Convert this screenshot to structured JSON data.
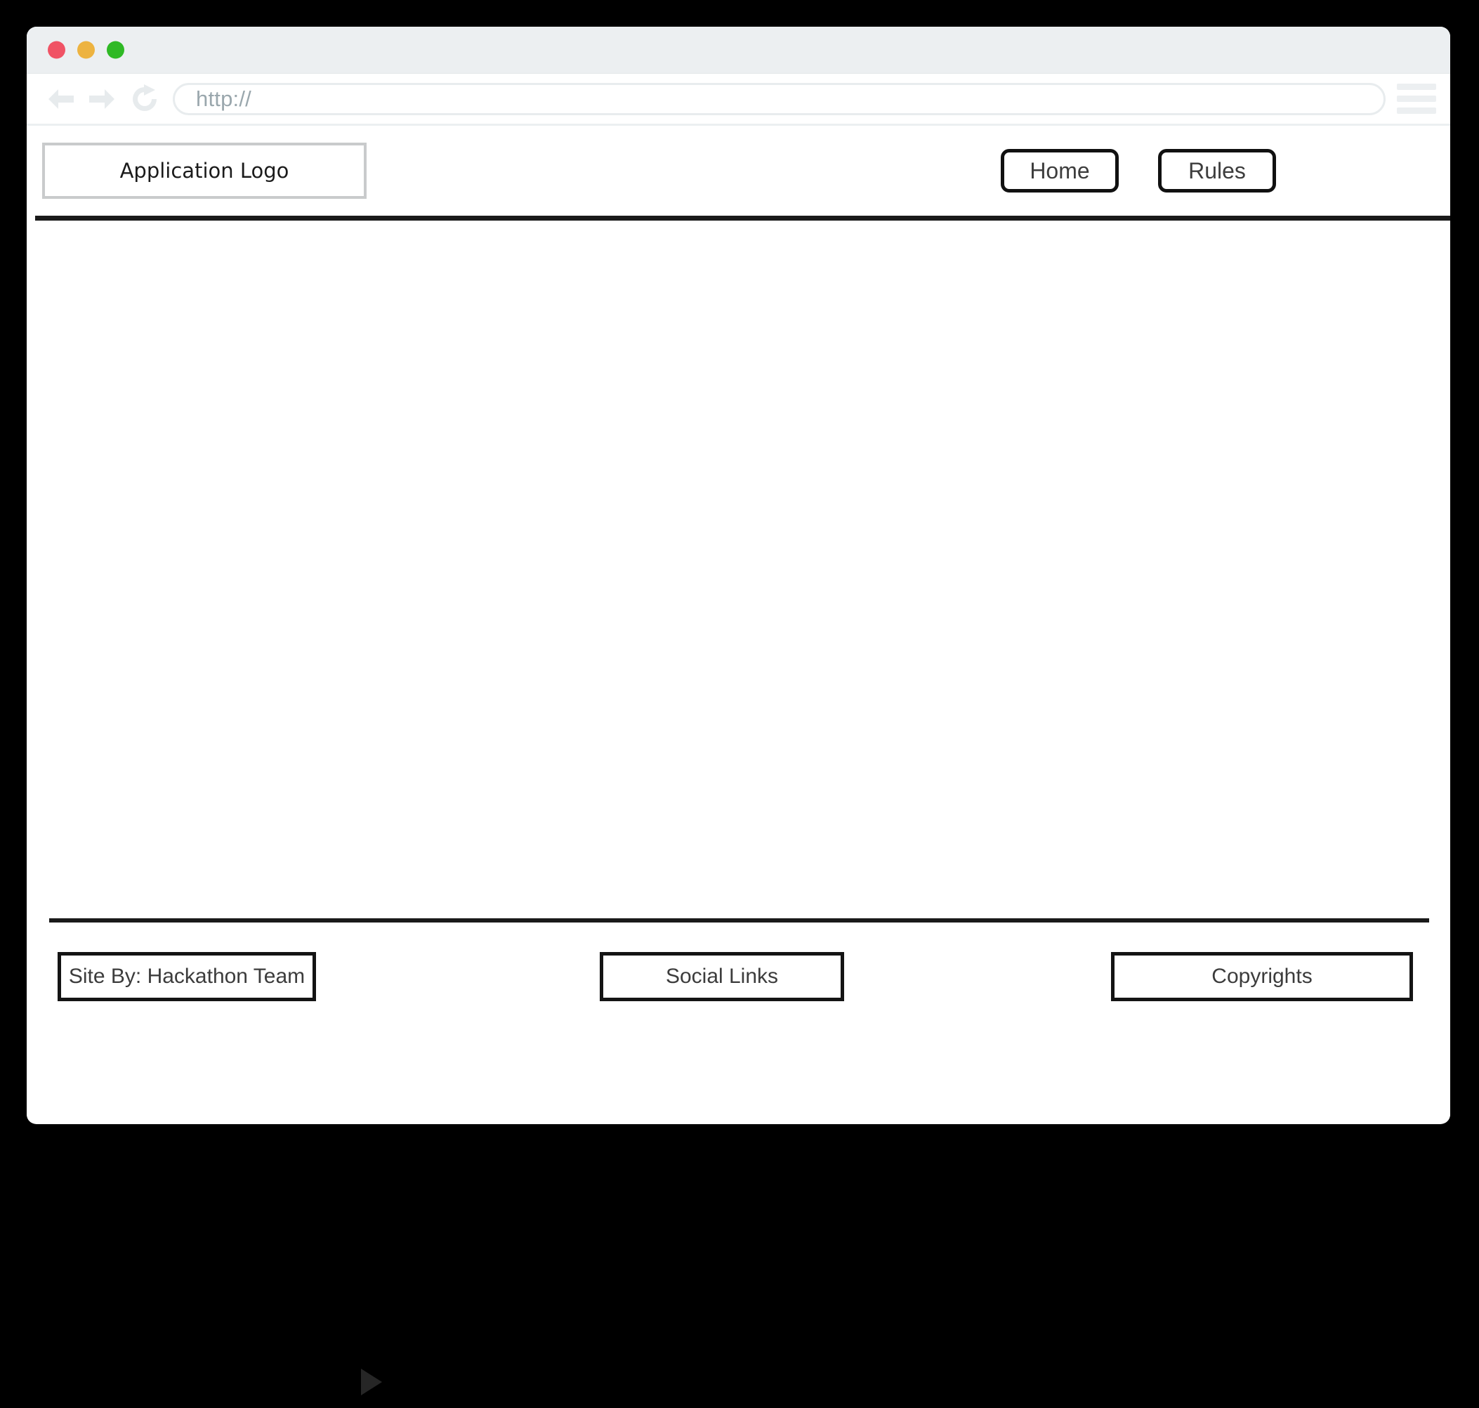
{
  "browser": {
    "traffic_lights": [
      {
        "name": "close",
        "color": "#f05365"
      },
      {
        "name": "minimize",
        "color": "#edb340"
      },
      {
        "name": "maximize",
        "color": "#2fb925"
      }
    ],
    "nav": {
      "back_icon": "arrow-left-icon",
      "forward_icon": "arrow-right-icon",
      "reload_icon": "reload-icon"
    },
    "address": {
      "value": "",
      "placeholder": "http://",
      "display": "http://"
    },
    "menu_icon": "hamburger-menu-icon"
  },
  "site": {
    "header": {
      "logo_label": "Application Logo",
      "nav_items": [
        {
          "label": "Home"
        },
        {
          "label": "Rules"
        }
      ]
    },
    "main": {
      "content": ""
    },
    "footer": {
      "boxes": [
        {
          "label": "Site By: Hackathon Team"
        },
        {
          "label": "Social Links"
        },
        {
          "label": "Copyrights"
        }
      ]
    }
  },
  "desktop": {
    "cursor_icon": "play-triangle-cursor"
  },
  "colors": {
    "titlebar_bg": "#eceff1",
    "border_black": "#141414",
    "logo_border": "#c9cbcc",
    "placeholder_text": "#9aa7ad",
    "canvas_bg": "#000000"
  }
}
